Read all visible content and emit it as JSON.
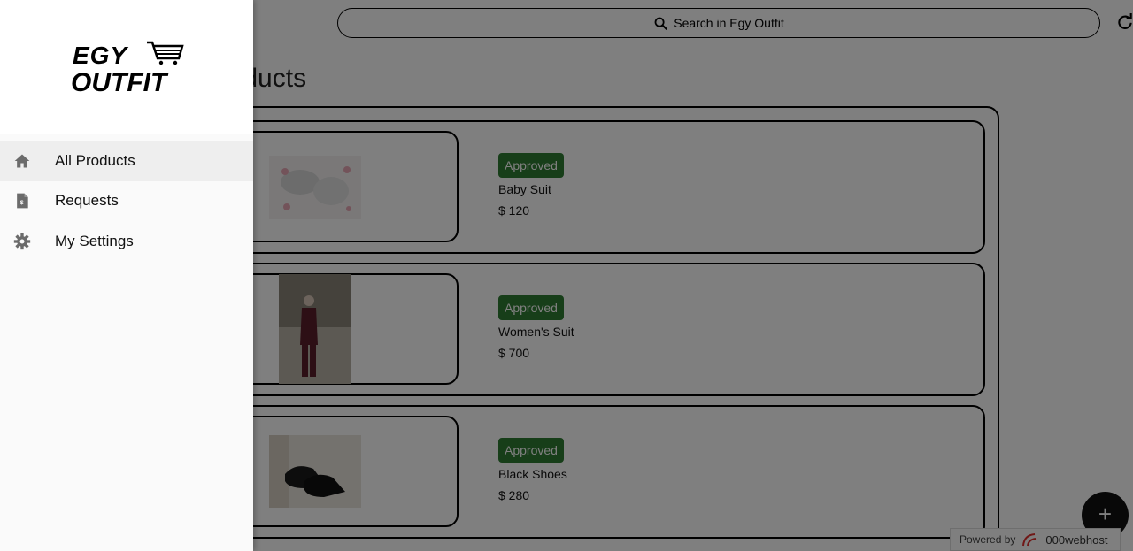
{
  "search": {
    "label": "Search in Egy Outfit"
  },
  "page": {
    "title": "All Products"
  },
  "products": [
    {
      "status": "Approved",
      "name": "Baby Suit",
      "price": "$ 120"
    },
    {
      "status": "Approved",
      "name": "Women's Suit",
      "price": "$ 700"
    },
    {
      "status": "Approved",
      "name": "Black Shoes",
      "price": "$ 280"
    }
  ],
  "fab": {
    "label": "+"
  },
  "footer": {
    "powered_by": "Powered by",
    "brand": "000webhost"
  },
  "drawer": {
    "logo_text": [
      "EGY",
      "OUTFIT"
    ],
    "items": [
      {
        "label": "All Products",
        "icon": "home-icon",
        "active": true
      },
      {
        "label": "Requests",
        "icon": "document-icon",
        "active": false
      },
      {
        "label": "My Settings",
        "icon": "gear-icon",
        "active": false
      }
    ]
  },
  "colors": {
    "approved": "#2e7d32",
    "drawer_active": "#eeeeee"
  }
}
